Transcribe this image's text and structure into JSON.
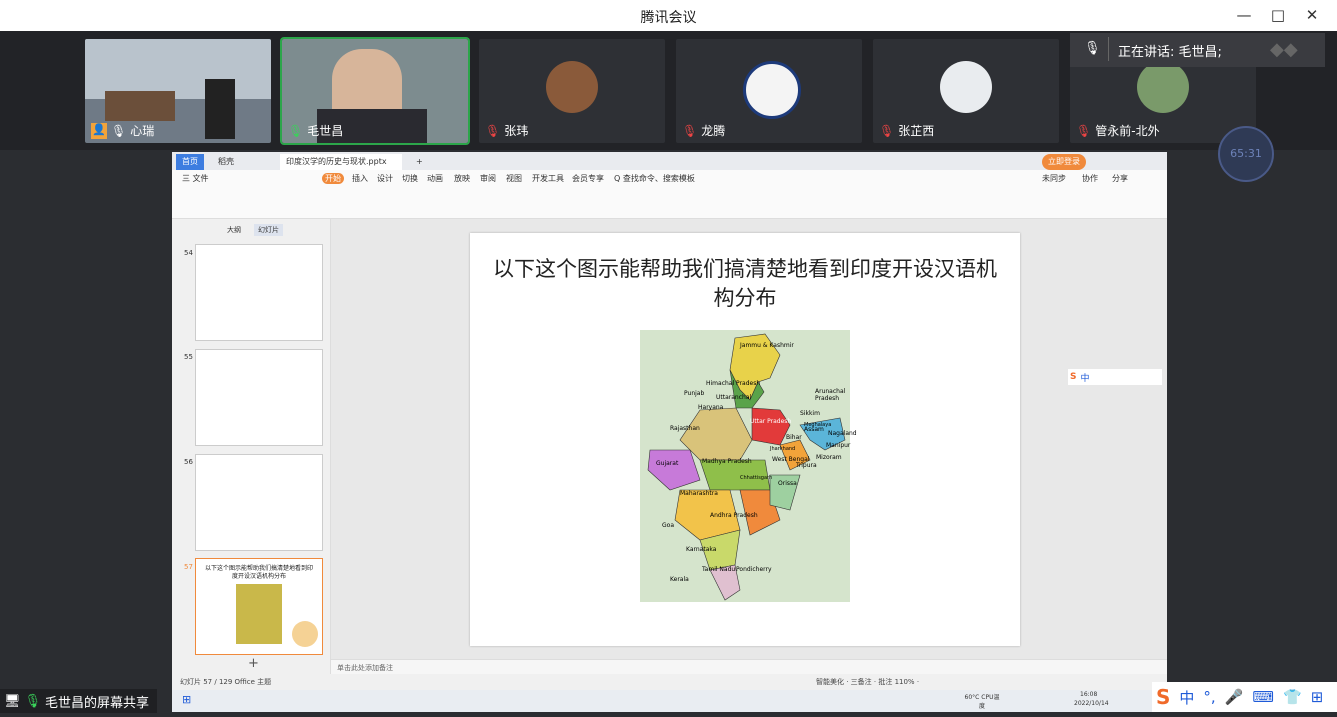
{
  "window": {
    "title": "腾讯会议",
    "controls": [
      "—",
      "□",
      "✕"
    ]
  },
  "participants": [
    {
      "name": "心瑞",
      "muted": false,
      "host": true
    },
    {
      "name": "毛世昌",
      "muted": false,
      "host": false
    },
    {
      "name": "张玮",
      "muted": true,
      "host": false
    },
    {
      "name": "龙腾",
      "muted": true,
      "host": false
    },
    {
      "name": "张芷西",
      "muted": true,
      "host": false
    },
    {
      "name": "管永前-北外",
      "muted": true,
      "host": false
    }
  ],
  "speaking": {
    "label": "正在讲话: 毛世昌;"
  },
  "timer": "65:31",
  "wps": {
    "tabs": [
      "首页",
      "稻壳",
      "印度汉学的历史与现状.pptx"
    ],
    "menu": [
      "三 文件",
      "开始",
      "插入",
      "设计",
      "切换",
      "动画",
      "放映",
      "审阅",
      "视图",
      "开发工具",
      "会员专享",
      "Q 查找命令、搜索模板",
      "未同步",
      "协作",
      "分享"
    ],
    "panel_tabs": [
      "大纲",
      "幻灯片"
    ],
    "slide_numbers": [
      "54",
      "55",
      "56",
      "57"
    ],
    "thumb57_title": "以下这个图示能帮助我们搞清楚地看到印度开设汉语机构分布",
    "notes_placeholder": "单击此处添加备注",
    "status_left": "幻灯片 57 / 129   Office 主题",
    "status_right": "智能美化 · 三备注 · 批注   110% ·"
  },
  "slide": {
    "title": "以下这个图示能帮助我们搞清楚地看到印度开设汉语机构分布",
    "map_states": [
      "Jammu & Kashmir",
      "Himachal Pradesh",
      "Punjab",
      "Uttaranchal",
      "Haryana",
      "Uttar Pradesh",
      "Rajasthan",
      "Gujarat",
      "Madhya Pradesh",
      "Bihar",
      "Sikkim",
      "Arunachal Pradesh",
      "Assam",
      "Nagaland",
      "Manipur",
      "Mizoram",
      "Tripura",
      "Meghalaya",
      "West Bengal",
      "Jharkhand",
      "Orissa",
      "Chhattisgarh",
      "Maharashtra",
      "Goa",
      "Andhra Pradesh",
      "Karnataka",
      "Tamil Nadu",
      "Kerala",
      "Pondicherry"
    ]
  },
  "taskbar": {
    "cpu": "60°C CPU温度",
    "time": "16:08",
    "date": "2022/10/14"
  },
  "share_label": "毛世昌的屏幕共享",
  "ime": {
    "chars": [
      "中",
      "°,",
      "🎤",
      "⌨",
      "👕",
      "⊞"
    ]
  }
}
